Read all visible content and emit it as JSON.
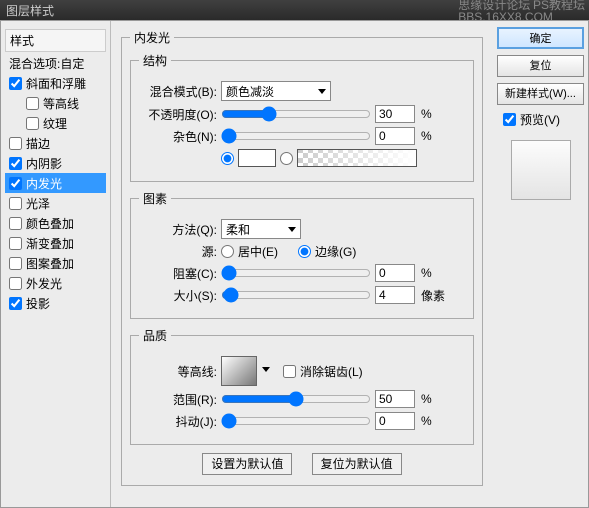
{
  "header": {
    "title": "图层样式",
    "watermark1": "思缘设计论坛",
    "watermark2": "PS教程坛",
    "watermark3": "BBS.16XX8.COM"
  },
  "left": {
    "styles_label": "样式",
    "blend_label": "混合选项:自定",
    "items": [
      {
        "label": "斜面和浮雕",
        "checked": true,
        "indent": 0
      },
      {
        "label": "等高线",
        "checked": false,
        "indent": 1
      },
      {
        "label": "纹理",
        "checked": false,
        "indent": 1
      },
      {
        "label": "描边",
        "checked": false,
        "indent": 0
      },
      {
        "label": "内阴影",
        "checked": true,
        "indent": 0
      },
      {
        "label": "内发光",
        "checked": true,
        "indent": 0,
        "selected": true
      },
      {
        "label": "光泽",
        "checked": false,
        "indent": 0
      },
      {
        "label": "颜色叠加",
        "checked": false,
        "indent": 0
      },
      {
        "label": "渐变叠加",
        "checked": false,
        "indent": 0
      },
      {
        "label": "图案叠加",
        "checked": false,
        "indent": 0
      },
      {
        "label": "外发光",
        "checked": false,
        "indent": 0
      },
      {
        "label": "投影",
        "checked": true,
        "indent": 0
      }
    ]
  },
  "panel": {
    "title": "内发光",
    "structure": {
      "title": "结构",
      "blend_mode_label": "混合模式(B):",
      "blend_mode_value": "颜色减淡",
      "opacity_label": "不透明度(O):",
      "opacity_value": "30",
      "opacity_unit": "%",
      "noise_label": "杂色(N):",
      "noise_value": "0",
      "noise_unit": "%"
    },
    "elements": {
      "title": "图素",
      "technique_label": "方法(Q):",
      "technique_value": "柔和",
      "source_label": "源:",
      "source_center": "居中(E)",
      "source_edge": "边缘(G)",
      "choke_label": "阻塞(C):",
      "choke_value": "0",
      "choke_unit": "%",
      "size_label": "大小(S):",
      "size_value": "4",
      "size_unit": "像素"
    },
    "quality": {
      "title": "品质",
      "contour_label": "等高线:",
      "antialias_label": "消除锯齿(L)",
      "range_label": "范围(R):",
      "range_value": "50",
      "range_unit": "%",
      "jitter_label": "抖动(J):",
      "jitter_value": "0",
      "jitter_unit": "%"
    },
    "defaults": {
      "set": "设置为默认值",
      "reset": "复位为默认值"
    }
  },
  "right": {
    "ok": "确定",
    "cancel": "复位",
    "new_style": "新建样式(W)...",
    "preview": "预览(V)"
  }
}
